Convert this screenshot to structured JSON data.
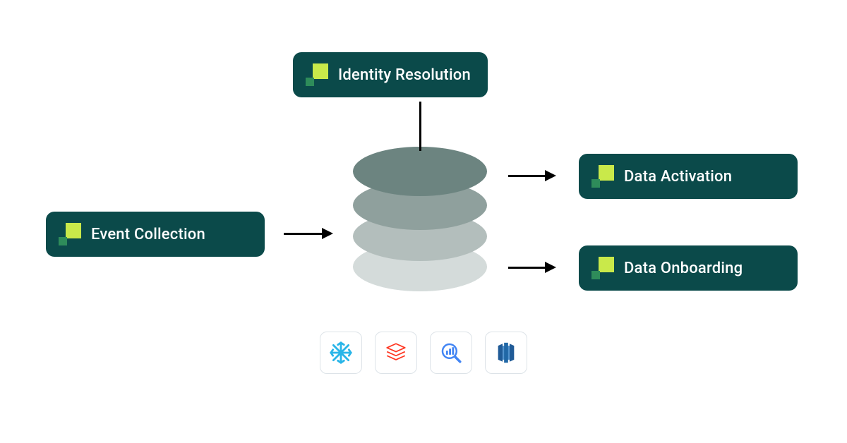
{
  "cards": {
    "event": {
      "label": "Event Collection"
    },
    "identity": {
      "label": "Identity Resolution"
    },
    "activation": {
      "label": "Data Activation"
    },
    "onboarding": {
      "label": "Data Onboarding"
    }
  },
  "integrations": [
    {
      "name": "snowflake"
    },
    {
      "name": "databricks"
    },
    {
      "name": "bigquery"
    },
    {
      "name": "redshift"
    }
  ],
  "colors": {
    "card_bg": "#0b4a4a",
    "card_text": "#ffffff",
    "logo_primary": "#c9e94a",
    "logo_secondary": "#2e8c5a"
  }
}
